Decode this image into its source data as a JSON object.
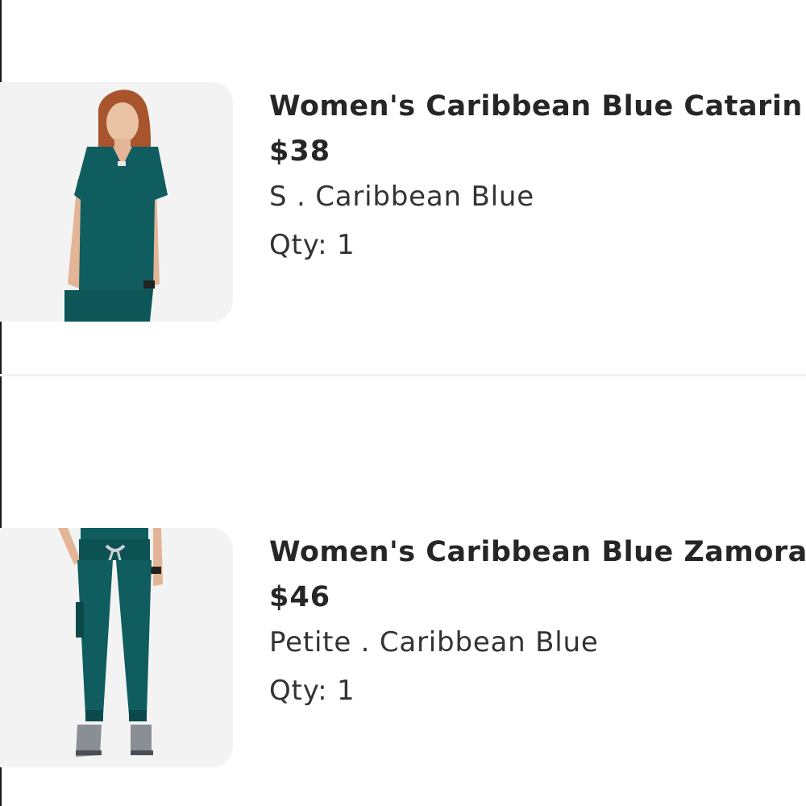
{
  "cart": {
    "items": [
      {
        "title": "Women's Caribbean Blue Catarin",
        "price": "$38",
        "variant": "S . Caribbean Blue",
        "qty": "Qty: 1",
        "image_icon": "scrub-top-photo"
      },
      {
        "title": "Women's Caribbean Blue Zamora",
        "price": "$46",
        "variant": "Petite . Caribbean Blue",
        "qty": "Qty: 1",
        "image_icon": "scrub-pants-photo"
      }
    ]
  },
  "colors": {
    "scrub_teal": "#0f5d5e",
    "thumb_bg": "#f3f3f3",
    "text": "#262626"
  }
}
